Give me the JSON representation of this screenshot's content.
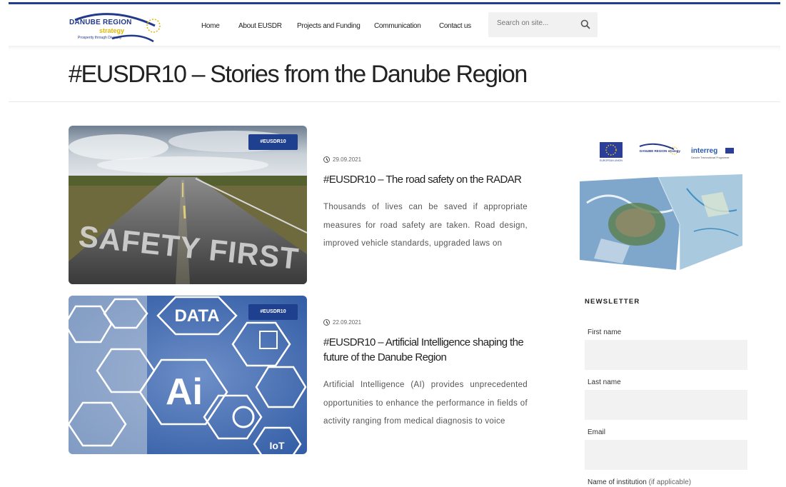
{
  "header": {
    "logo": {
      "line1": "DANUBE REGION",
      "line2": "strategy",
      "tagline": "Prosperity through Diversity"
    },
    "nav": [
      "Home",
      "About EUSDR",
      "Projects and Funding",
      "Communication",
      "Contact us"
    ],
    "search_placeholder": "Search on site..."
  },
  "page": {
    "title": "#EUSDR10 – Stories from the Danube Region"
  },
  "posts": [
    {
      "tag": "#EUSDR10",
      "image_text": "SAFETY FIRST",
      "date": "29.09.2021",
      "title": "#EUSDR10 – The road safety on the RADAR",
      "excerpt": "Thousands of lives can be saved if appropriate measures for road safety are taken. Road design, improved vehicle standards, upgraded laws on"
    },
    {
      "tag": "#EUSDR10",
      "image_text": [
        "DATA",
        "Ai",
        "IoT"
      ],
      "date": "22.09.2021",
      "title": "#EUSDR10 – Artificial Intelligence shaping the future of the Danube Region",
      "excerpt": "Artificial Intelligence (AI) provides unprecedented opportunities to enhance the performance in fields of activity ranging from medical diagnosis to voice"
    }
  ],
  "sidebar": {
    "partner_logos": {
      "eu": "EUROPEAN UNION",
      "danube": "DANUBE REGION strategy",
      "interreg": "interreg",
      "interreg_sub": "Danube Transnational Programme"
    },
    "newsletter": {
      "heading": "NEWSLETTER",
      "fields": [
        "First name",
        "Last name",
        "Email"
      ],
      "institution_label": "Name of institution",
      "institution_hint": "(if applicable)"
    }
  },
  "colors": {
    "brand_blue": "#1f3f8f",
    "brand_yellow": "#e0b800",
    "field_bg": "#f2f2f2"
  }
}
